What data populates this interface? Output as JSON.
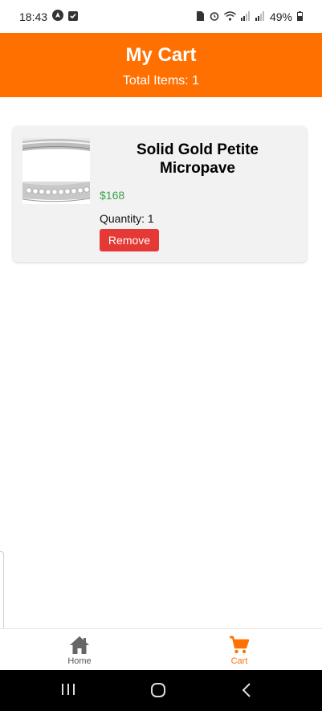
{
  "status_bar": {
    "time": "18:43",
    "battery": "49%",
    "icons": [
      "navigation-icon",
      "checkbox-icon",
      "sim-icon",
      "alarm-icon",
      "wifi-icon",
      "signal-icon",
      "battery-icon"
    ]
  },
  "header": {
    "title": "My Cart",
    "total_items": "Total Items: 1"
  },
  "cart": {
    "items": [
      {
        "name": "Solid Gold Petite Micropave",
        "price": "$168",
        "quantity": "Quantity: 1",
        "remove_label": "Remove",
        "image": "ring-thumbnail"
      }
    ]
  },
  "tabs": [
    {
      "label": "Home",
      "icon": "home-icon",
      "active": false
    },
    {
      "label": "Cart",
      "icon": "cart-icon",
      "active": true
    }
  ],
  "colors": {
    "accent": "#ff7000",
    "price": "#3aa346",
    "remove": "#e53935"
  }
}
